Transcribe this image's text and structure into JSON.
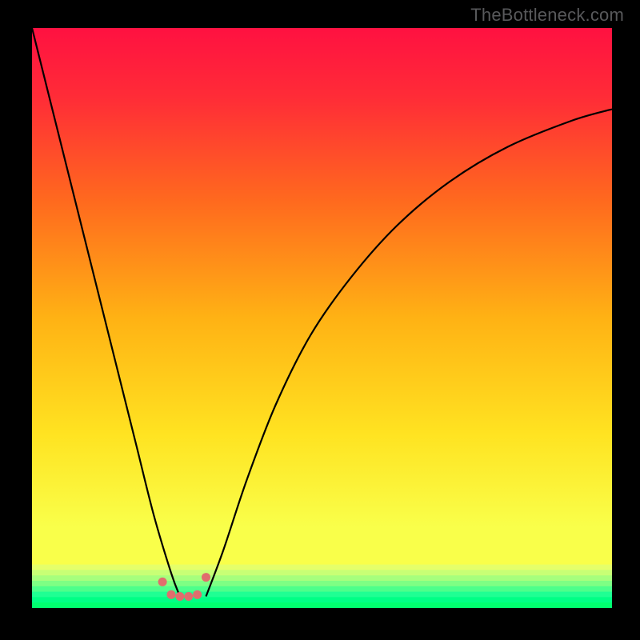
{
  "watermark": "TheBottleneck.com",
  "chart_data": {
    "type": "line",
    "title": "",
    "xlabel": "",
    "ylabel": "",
    "xlim": [
      0,
      100
    ],
    "ylim": [
      0,
      100
    ],
    "grid": false,
    "series": [
      {
        "name": "curve-left",
        "x": [
          0,
          3,
          6,
          9,
          12,
          15,
          18,
          21,
          24,
          25.5
        ],
        "y": [
          100,
          88,
          76,
          64,
          52,
          40,
          28,
          16,
          6,
          2
        ]
      },
      {
        "name": "curve-right",
        "x": [
          30,
          33,
          37,
          42,
          48,
          55,
          63,
          72,
          82,
          93,
          100
        ],
        "y": [
          2,
          10,
          22,
          35,
          47,
          57,
          66,
          73.5,
          79.5,
          84,
          86
        ]
      }
    ],
    "highlight_band": {
      "y_range": [
        0,
        7
      ],
      "coral_dots_x": [
        22.5,
        24,
        25.5,
        27,
        28.5,
        30
      ],
      "coral_dots_y": [
        4.5,
        2.3,
        2.0,
        2.0,
        2.3,
        5.3
      ],
      "dot_color": "#e06d6d"
    },
    "background_gradient": {
      "stops": [
        {
          "pos": 0.0,
          "color": "#ff1141"
        },
        {
          "pos": 0.12,
          "color": "#ff2c37"
        },
        {
          "pos": 0.3,
          "color": "#ff6a1e"
        },
        {
          "pos": 0.5,
          "color": "#ffb214"
        },
        {
          "pos": 0.7,
          "color": "#ffe321"
        },
        {
          "pos": 0.86,
          "color": "#f9ff4a"
        },
        {
          "pos": 1.0,
          "color": "#f9ff4a"
        }
      ]
    },
    "bottom_glow_bands": [
      {
        "color": "#e5ff6a"
      },
      {
        "color": "#c8ff75"
      },
      {
        "color": "#a6ff7d"
      },
      {
        "color": "#7eff84"
      },
      {
        "color": "#4dff8b"
      },
      {
        "color": "#1fff93"
      },
      {
        "color": "#00ff85"
      },
      {
        "color": "#00ff6f"
      }
    ]
  }
}
